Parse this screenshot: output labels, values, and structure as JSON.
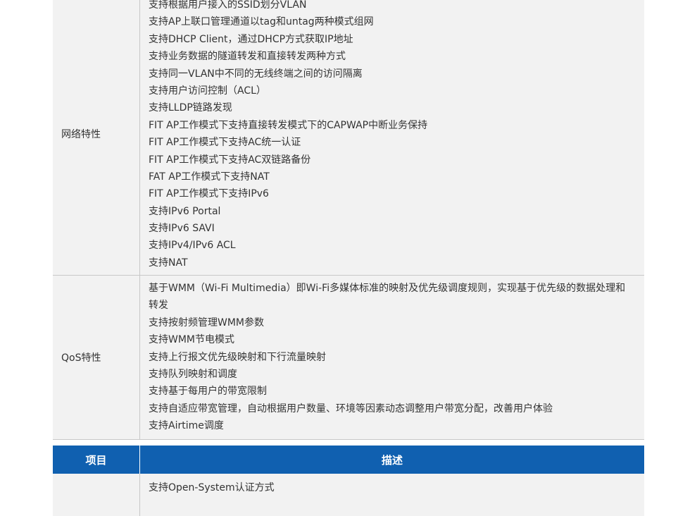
{
  "sections": [
    {
      "category": "网络特性",
      "items": [
        "支持根据用户接入的SSID划分VLAN",
        "支持AP上联口管理通道以tag和untag两种模式组网",
        "支持DHCP Client，通过DHCP方式获取IP地址",
        "支持业务数据的隧道转发和直接转发两种方式",
        "支持同一VLAN中不同的无线终端之间的访问隔离",
        "支持用户访问控制（ACL）",
        "支持LLDP链路发现",
        "FIT AP工作模式下支持直接转发模式下的CAPWAP中断业务保持",
        "FIT AP工作模式下支持AC统一认证",
        "FIT AP工作模式下支持AC双链路备份",
        "FAT AP工作模式下支持NAT",
        "FIT AP工作模式下支持IPv6",
        "支持IPv6 Portal",
        "支持IPv6 SAVI",
        "支持IPv4/IPv6 ACL",
        "支持NAT"
      ]
    },
    {
      "category": "QoS特性",
      "items": [
        "基于WMM（Wi-Fi Multimedia）即Wi-Fi多媒体标准的映射及优先级调度规则，实现基于优先级的数据处理和",
        "转发",
        "支持按射频管理WMM参数",
        "支持WMM节电模式",
        "支持上行报文优先级映射和下行流量映射",
        "支持队列映射和调度",
        "支持基于每用户的带宽限制",
        "支持自适应带宽管理，自动根据用户数量、环境等因素动态调整用户带宽分配，改善用户体验",
        "支持Airtime调度"
      ]
    }
  ],
  "header": {
    "item": "项目",
    "description": "描述"
  },
  "next_section": {
    "items": [
      "支持Open-System认证方式"
    ]
  },
  "colors": {
    "header_bg": "#1060b0",
    "row_bg": "#f2f2f2",
    "border": "#c8c8c8"
  }
}
